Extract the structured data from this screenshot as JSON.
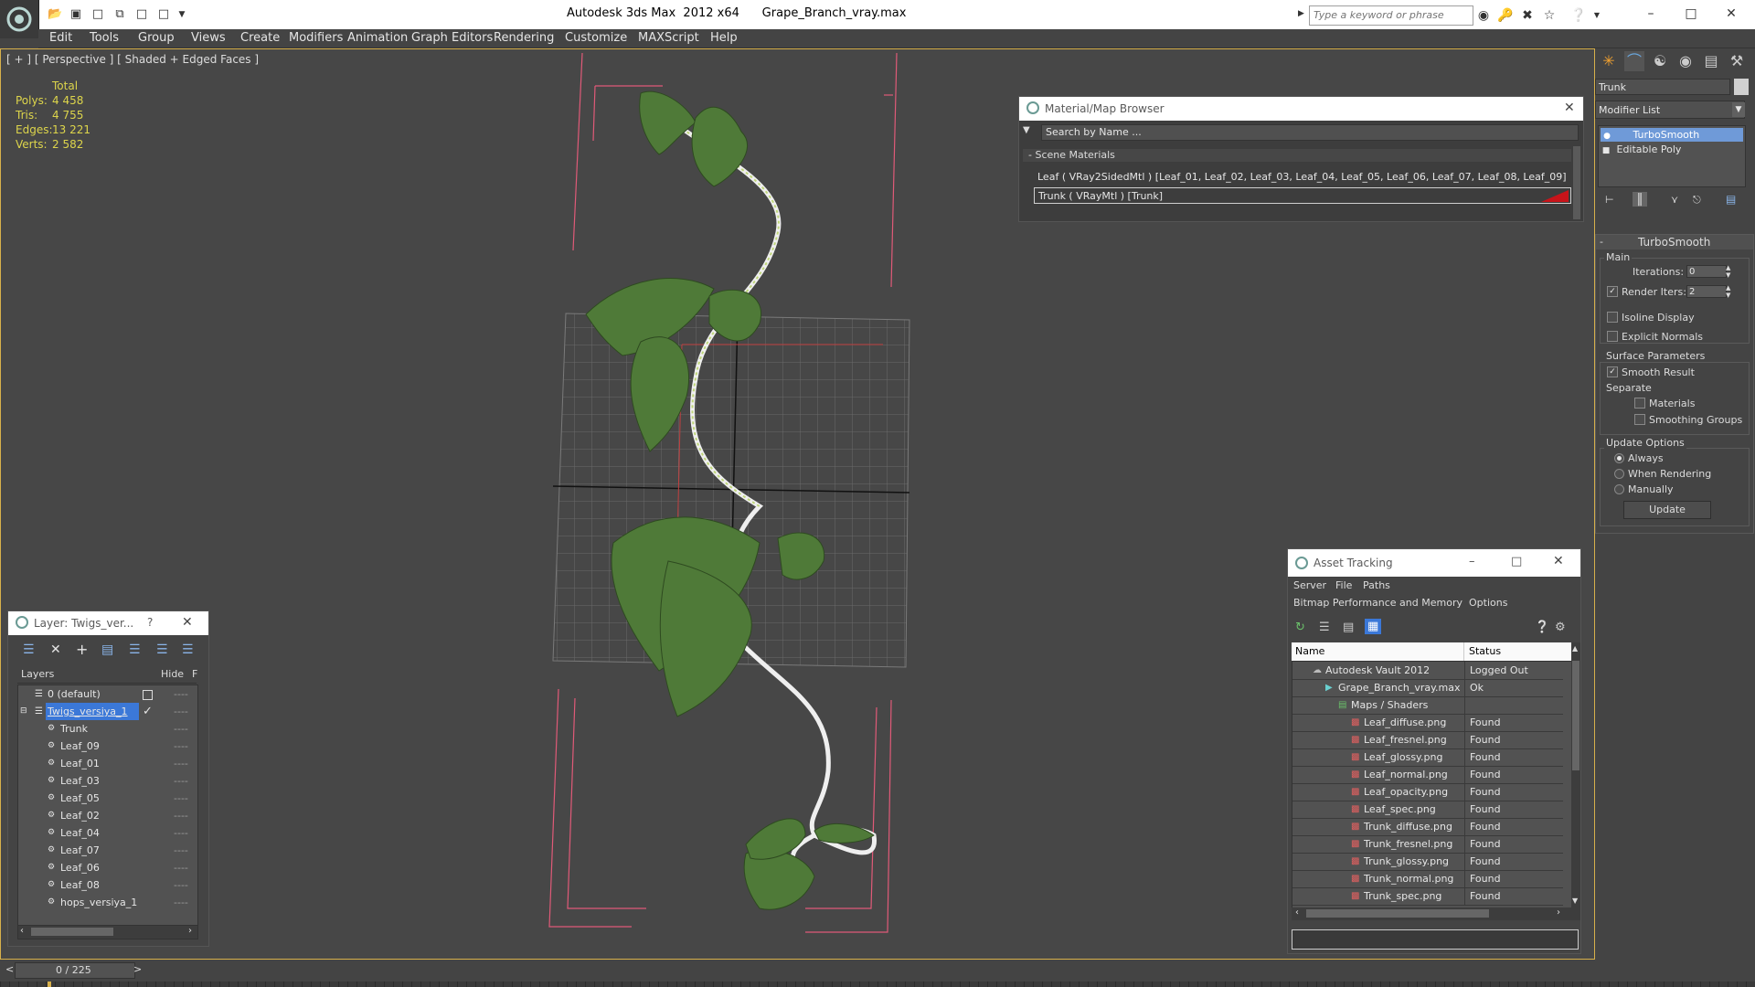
{
  "window": {
    "title": "Autodesk 3ds Max  2012 x64      Grape_Branch_vray.max",
    "search_placeholder": "Type a keyword or phrase"
  },
  "menu": [
    "Edit",
    "Tools",
    "Group",
    "Views",
    "Create",
    "Modifiers",
    "Animation",
    "Graph Editors",
    "Rendering",
    "Customize",
    "MAXScript",
    "Help"
  ],
  "viewport": {
    "label": "[ + ] [ Perspective ] [ Shaded + Edged Faces ]",
    "stats": {
      "header": "Total",
      "rows": [
        {
          "label": "Polys:",
          "value": "4 458"
        },
        {
          "label": "Tris:",
          "value": "4 755"
        },
        {
          "label": "Edges:",
          "value": "13 221"
        },
        {
          "label": "Verts:",
          "value": "2 582"
        }
      ]
    }
  },
  "material_browser": {
    "title": "Material/Map Browser",
    "search_placeholder": "Search by Name ...",
    "section": "- Scene Materials",
    "rows": [
      "Leaf  ( VRay2SidedMtl )  [Leaf_01, Leaf_02, Leaf_03, Leaf_04, Leaf_05, Leaf_06, Leaf_07, Leaf_08, Leaf_09]",
      "Trunk  ( VRayMtl )  [Trunk]"
    ],
    "swatch_color": "#c8141a"
  },
  "command_panel": {
    "object_name": "Trunk",
    "modifier_list": "Modifier List",
    "stack": [
      "TurboSmooth",
      "Editable Poly"
    ],
    "rollout_title": "TurboSmooth",
    "main_label": "Main",
    "iterations_label": "Iterations:",
    "iterations_value": "0",
    "render_iters_label": "Render Iters:",
    "render_iters_value": "2",
    "isoline_label": "Isoline Display",
    "explicit_normals_label": "Explicit Normals",
    "surface_params_label": "Surface Parameters",
    "smooth_result_label": "Smooth Result",
    "separate_label": "Separate",
    "materials_label": "Materials",
    "smoothing_groups_label": "Smoothing Groups",
    "update_options_label": "Update Options",
    "always_label": "Always",
    "when_rendering_label": "When Rendering",
    "manually_label": "Manually",
    "update_button": "Update"
  },
  "layer_window": {
    "title": "Layer: Twigs_ver...",
    "help": "?",
    "col_layers": "Layers",
    "col_hide": "Hide",
    "col_f": "F",
    "rows": [
      {
        "name": "0 (default)",
        "indent": 1,
        "type": "layer"
      },
      {
        "name": "Twigs_versiya_1",
        "indent": 1,
        "type": "layer",
        "selected": true
      },
      {
        "name": "Trunk",
        "indent": 2,
        "type": "object"
      },
      {
        "name": "Leaf_09",
        "indent": 2,
        "type": "object"
      },
      {
        "name": "Leaf_01",
        "indent": 2,
        "type": "object"
      },
      {
        "name": "Leaf_03",
        "indent": 2,
        "type": "object"
      },
      {
        "name": "Leaf_05",
        "indent": 2,
        "type": "object"
      },
      {
        "name": "Leaf_02",
        "indent": 2,
        "type": "object"
      },
      {
        "name": "Leaf_04",
        "indent": 2,
        "type": "object"
      },
      {
        "name": "Leaf_07",
        "indent": 2,
        "type": "object"
      },
      {
        "name": "Leaf_06",
        "indent": 2,
        "type": "object"
      },
      {
        "name": "Leaf_08",
        "indent": 2,
        "type": "object"
      },
      {
        "name": "hops_versiya_1",
        "indent": 2,
        "type": "object"
      }
    ]
  },
  "asset_tracking": {
    "title": "Asset Tracking",
    "menu1": [
      "Server",
      "File",
      "Paths"
    ],
    "menu2": [
      "Bitmap Performance and Memory",
      "Options"
    ],
    "col_name": "Name",
    "col_status": "Status",
    "rows": [
      {
        "name": "Autodesk Vault 2012",
        "status": "Logged Out",
        "indent": 1
      },
      {
        "name": "Grape_Branch_vray.max",
        "status": "Ok",
        "indent": 2
      },
      {
        "name": "Maps / Shaders",
        "status": "",
        "indent": 3
      },
      {
        "name": "Leaf_diffuse.png",
        "status": "Found",
        "indent": 4
      },
      {
        "name": "Leaf_fresnel.png",
        "status": "Found",
        "indent": 4
      },
      {
        "name": "Leaf_glossy.png",
        "status": "Found",
        "indent": 4
      },
      {
        "name": "Leaf_normal.png",
        "status": "Found",
        "indent": 4
      },
      {
        "name": "Leaf_opacity.png",
        "status": "Found",
        "indent": 4
      },
      {
        "name": "Leaf_spec.png",
        "status": "Found",
        "indent": 4
      },
      {
        "name": "Trunk_diffuse.png",
        "status": "Found",
        "indent": 4
      },
      {
        "name": "Trunk_fresnel.png",
        "status": "Found",
        "indent": 4
      },
      {
        "name": "Trunk_glossy.png",
        "status": "Found",
        "indent": 4
      },
      {
        "name": "Trunk_normal.png",
        "status": "Found",
        "indent": 4
      },
      {
        "name": "Trunk_spec.png",
        "status": "Found",
        "indent": 4
      }
    ]
  },
  "timeline": {
    "frame": "0 / 225"
  },
  "colors": {
    "accent": "#d7b04b",
    "selection": "#3b78d8",
    "stat_text": "#ddd54b",
    "leaf": "#4f7a38"
  }
}
